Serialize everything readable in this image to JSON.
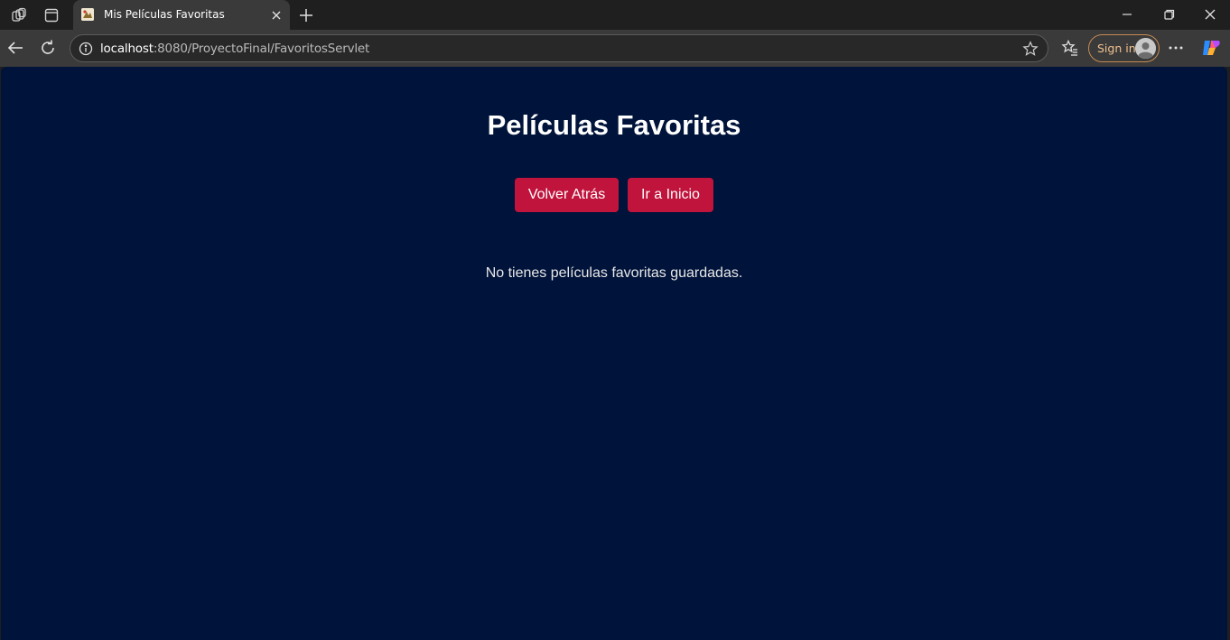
{
  "browser": {
    "tab_title": "Mis Películas Favoritas",
    "url_host": "localhost",
    "url_path": ":8080/ProyectoFinal/FavoritosServlet",
    "signin_label": "Sign in"
  },
  "page": {
    "title": "Películas Favoritas",
    "back_button": "Volver Atrás",
    "home_button": "Ir a Inicio",
    "empty_message": "No tienes películas favoritas guardadas."
  },
  "colors": {
    "page_background": "#00133a",
    "button_background": "#c0143c",
    "browser_chrome": "#1f1f1f"
  }
}
